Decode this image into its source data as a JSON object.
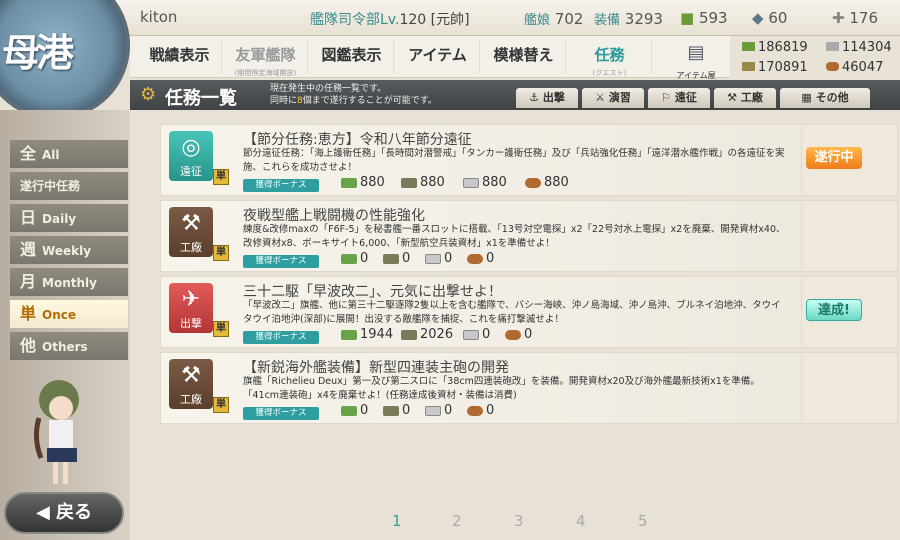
{
  "header": {
    "logo": "母港",
    "player": "kiton",
    "hq_label": "艦隊司令部Lv.",
    "hq_level": "120",
    "rank": "[元帥]",
    "ships_label": "艦娘",
    "ships": "702",
    "equip_label": "装備",
    "equip": "3293",
    "bucket": "593",
    "devmat": "60",
    "screw": "176"
  },
  "nav": [
    {
      "label": "戦績表示"
    },
    {
      "label": "友軍艦隊",
      "sub": "(期間限定海域開放)"
    },
    {
      "label": "図鑑表示"
    },
    {
      "label": "アイテム"
    },
    {
      "label": "模様替え"
    },
    {
      "label": "任務",
      "sub": "(クエスト)"
    },
    {
      "label": "アイテム屋"
    }
  ],
  "resources": {
    "fuel": "186819",
    "ammo": "170891",
    "steel": "114304",
    "baux": "46047"
  },
  "section": {
    "title": "任務一覧",
    "desc1": "現在発生中の任務一覧です。",
    "desc2a": "同時に",
    "desc2num": "8",
    "desc2b": "個まで遂行することが可能です。"
  },
  "filter_tabs": [
    "出撃",
    "演習",
    "遠征",
    "工廠",
    "その他"
  ],
  "left_filters": [
    {
      "big": "全",
      "label": "All"
    },
    {
      "big": "",
      "label": "遂行中任務"
    },
    {
      "big": "日",
      "label": "Daily"
    },
    {
      "big": "週",
      "label": "Weekly"
    },
    {
      "big": "月",
      "label": "Monthly"
    },
    {
      "big": "単",
      "label": "Once"
    },
    {
      "big": "他",
      "label": "Others"
    }
  ],
  "back_label": "戻る",
  "quests": [
    {
      "cat": "遠征",
      "tan": "単",
      "title": "【節分任務:恵方】令和八年節分遠征",
      "desc": "節分遠征任務：「海上護衛任務」「長時間対潜警戒」「タンカー護衛任務」及び「兵站強化任務」「遠洋潜水艦作戦」の各遠征を実施、これらを成功させよ！",
      "bonus": "獲得ボーナス",
      "fuel": "880",
      "ammo": "880",
      "steel": "880",
      "baux": "880",
      "status": "遂行中"
    },
    {
      "cat": "工廠",
      "tan": "単",
      "title": "夜戦型艦上戦闘機の性能強化",
      "desc": "練度&改修maxの「F6F-5」を秘書艦一番スロットに搭載、「13号対空電探」x2「22号対水上電探」x2を廃棄、開発資材x40、改修資材x8、ボーキサイト6,000、「新型航空兵装資材」x1を準備せよ！",
      "bonus": "獲得ボーナス",
      "fuel": "0",
      "ammo": "0",
      "steel": "0",
      "baux": "0",
      "status": ""
    },
    {
      "cat": "出撃",
      "tan": "単",
      "title": "三十二駆「早波改二」、元気に出撃せよ！",
      "desc": "「早波改二」旗艦、他に第三十二駆逐隊2隻以上を含む艦隊で、バシー海峡、沖ノ島海域、沖ノ島沖、ブルネイ泊地沖、タウイタウイ泊地沖(深部)に展開！出没する敵艦隊を捕捉、これを痛打撃滅せよ！",
      "bonus": "獲得ボーナス",
      "fuel": "1944",
      "ammo": "2026",
      "steel": "0",
      "baux": "0",
      "status": "達成!"
    },
    {
      "cat": "工廠",
      "tan": "単",
      "title": "【新鋭海外艦装備】新型四連装主砲の開発",
      "desc": "旗艦「Richelieu Deux」第一及び第二スロに「38cm四連装砲改」を装備。開発資材x20及び海外艦最新技術x1を準備。「41cm連装砲」x4を廃棄せよ！(任務達成後資材・装備は消費)",
      "bonus": "獲得ボーナス",
      "fuel": "0",
      "ammo": "0",
      "steel": "0",
      "baux": "0",
      "status": ""
    }
  ],
  "pages": [
    "1",
    "2",
    "3",
    "4",
    "5"
  ],
  "current_page": "1"
}
